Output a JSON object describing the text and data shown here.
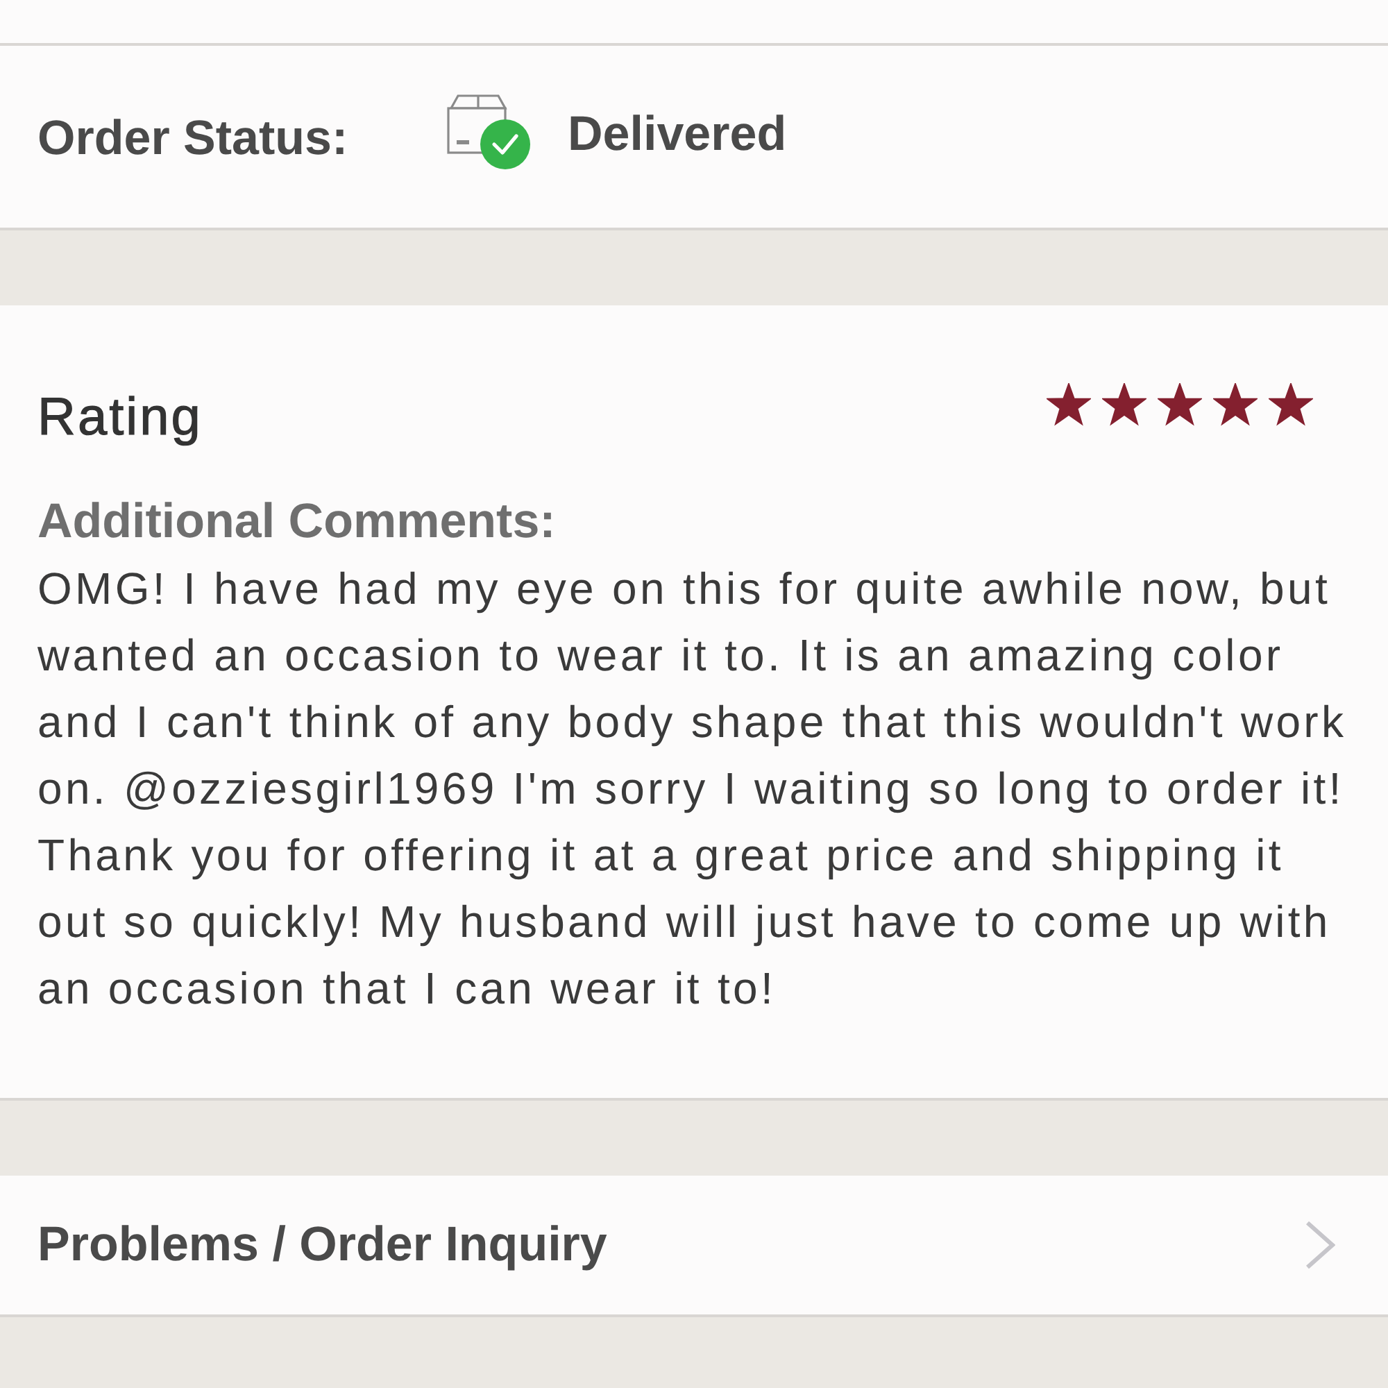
{
  "order_status": {
    "label": "Order Status:",
    "value": "Delivered"
  },
  "rating": {
    "title": "Rating",
    "stars": 5
  },
  "comments": {
    "label": "Additional Comments:",
    "text": "OMG! I have had my eye on this for quite awhile now, but wanted an occasion to wear it to. It is an amazing color and I can't think of any body shape that this wouldn't work on. @ozziesgirl1969 I'm sorry I waiting so long to order it! Thank you for offering it at a great price and shipping it out so quickly! My husband will just have to come up with an occasion that I can wear it to!"
  },
  "inquiry": {
    "label": "Problems / Order Inquiry"
  }
}
